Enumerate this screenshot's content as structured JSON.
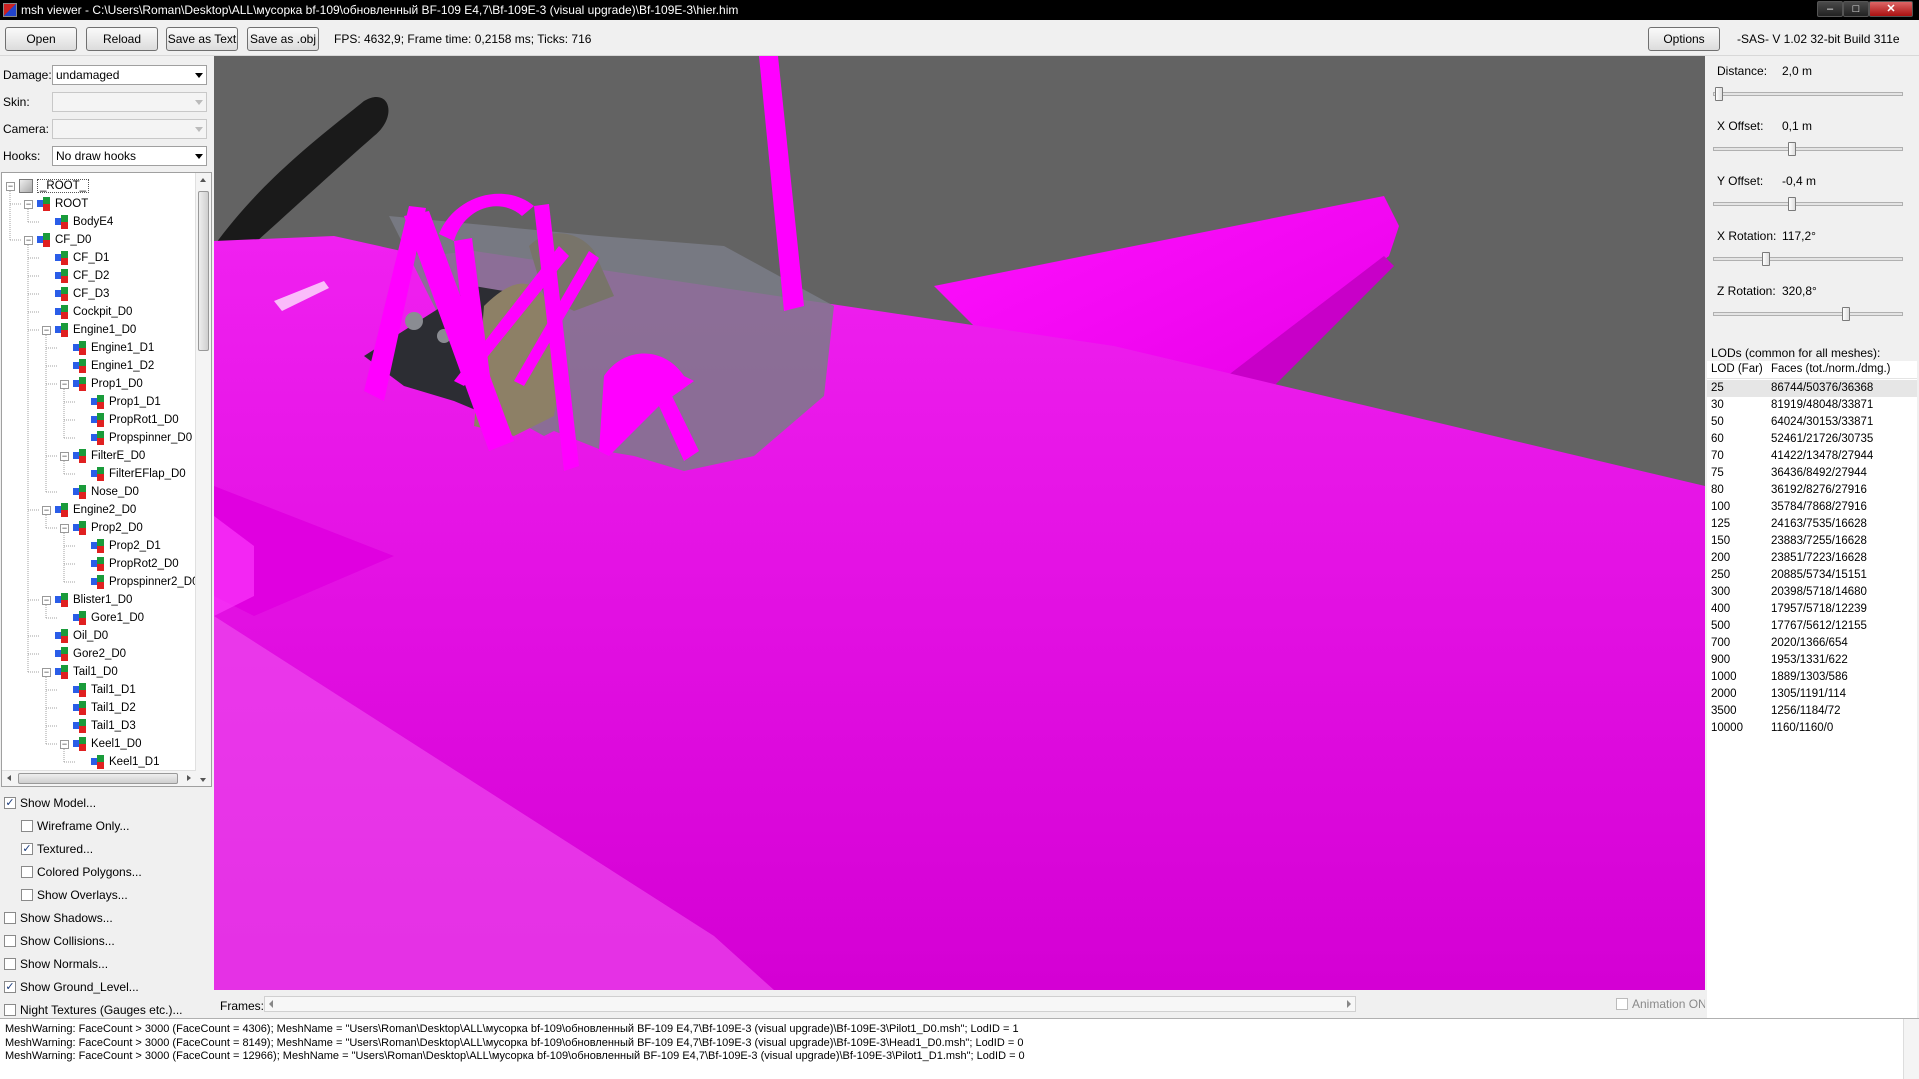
{
  "window": {
    "title": "msh viewer - C:\\Users\\Roman\\Desktop\\ALL\\мусорка bf-109\\обновленный BF-109 E4,7\\Bf-109E-3 (visual upgrade)\\Bf-109E-3\\hier.him",
    "min": "–",
    "max": "□",
    "close": "✕"
  },
  "toolbar": {
    "open": "Open",
    "reload": "Reload",
    "save_text": "Save as Text",
    "save_obj": "Save as .obj",
    "stats": "FPS: 4632,9; Frame time: 0,2158 ms; Ticks: 716",
    "options": "Options",
    "version": "-SAS- V 1.02  32-bit  Build 311e"
  },
  "left": {
    "damage_label": "Damage:",
    "damage_value": "undamaged",
    "skin_label": "Skin:",
    "skin_value": "",
    "camera_label": "Camera:",
    "camera_value": "",
    "hooks_label": "Hooks:",
    "hooks_value": "No draw hooks"
  },
  "tree": [
    {
      "label": "_ROOT_",
      "depth": 0,
      "exp": true,
      "root": true
    },
    {
      "label": "ROOT",
      "depth": 1,
      "exp": true
    },
    {
      "label": "BodyE4",
      "depth": 2
    },
    {
      "label": "CF_D0",
      "depth": 1,
      "exp": true
    },
    {
      "label": "CF_D1",
      "depth": 2
    },
    {
      "label": "CF_D2",
      "depth": 2
    },
    {
      "label": "CF_D3",
      "depth": 2
    },
    {
      "label": "Cockpit_D0",
      "depth": 2
    },
    {
      "label": "Engine1_D0",
      "depth": 2,
      "exp": true
    },
    {
      "label": "Engine1_D1",
      "depth": 3
    },
    {
      "label": "Engine1_D2",
      "depth": 3
    },
    {
      "label": "Prop1_D0",
      "depth": 3,
      "exp": true
    },
    {
      "label": "Prop1_D1",
      "depth": 4
    },
    {
      "label": "PropRot1_D0",
      "depth": 4
    },
    {
      "label": "Propspinner_D0",
      "depth": 4
    },
    {
      "label": "FilterE_D0",
      "depth": 3,
      "exp": true
    },
    {
      "label": "FilterEFlap_D0",
      "depth": 4
    },
    {
      "label": "Nose_D0",
      "depth": 3
    },
    {
      "label": "Engine2_D0",
      "depth": 2,
      "exp": true
    },
    {
      "label": "Prop2_D0",
      "depth": 3,
      "exp": true
    },
    {
      "label": "Prop2_D1",
      "depth": 4
    },
    {
      "label": "PropRot2_D0",
      "depth": 4
    },
    {
      "label": "Propspinner2_D0",
      "depth": 4
    },
    {
      "label": "Blister1_D0",
      "depth": 2,
      "exp": true
    },
    {
      "label": "Gore1_D0",
      "depth": 3
    },
    {
      "label": "Oil_D0",
      "depth": 2
    },
    {
      "label": "Gore2_D0",
      "depth": 2
    },
    {
      "label": "Tail1_D0",
      "depth": 2,
      "exp": true
    },
    {
      "label": "Tail1_D1",
      "depth": 3
    },
    {
      "label": "Tail1_D2",
      "depth": 3
    },
    {
      "label": "Tail1_D3",
      "depth": 3
    },
    {
      "label": "Keel1_D0",
      "depth": 3,
      "exp": true
    },
    {
      "label": "Keel1_D1",
      "depth": 4
    }
  ],
  "options": [
    {
      "label": "Show Model...",
      "checked": true,
      "indent": 0
    },
    {
      "label": "Wireframe Only...",
      "checked": false,
      "indent": 1
    },
    {
      "label": "Textured...",
      "checked": true,
      "indent": 1
    },
    {
      "label": "Colored Polygons...",
      "checked": false,
      "indent": 1
    },
    {
      "label": "Show Overlays...",
      "checked": false,
      "indent": 1
    },
    {
      "label": "Show Shadows...",
      "checked": false,
      "indent": 0
    },
    {
      "label": "Show Collisions...",
      "checked": false,
      "indent": 0
    },
    {
      "label": "Show Normals...",
      "checked": false,
      "indent": 0
    },
    {
      "label": "Show Ground_Level...",
      "checked": true,
      "indent": 0
    },
    {
      "label": "Night Textures (Gauges etc.)...",
      "checked": false,
      "indent": 0
    }
  ],
  "frames": {
    "label": "Frames:",
    "animation": "Animation ON"
  },
  "right": {
    "sliders": [
      {
        "label": "Distance:",
        "value": "2,0 m",
        "pos": 0.01
      },
      {
        "label": "X Offset:",
        "value": "0,1 m",
        "pos": 0.41
      },
      {
        "label": "Y Offset:",
        "value": "-0,4 m",
        "pos": 0.41
      },
      {
        "label": "X Rotation:",
        "value": "117,2°",
        "pos": 0.27
      },
      {
        "label": "Z Rotation:",
        "value": "320,8°",
        "pos": 0.71
      }
    ],
    "lods_label": "LODs (common for all meshes):",
    "lod_header": "LOD (Far)",
    "faces_header": "Faces (tot./norm./dmg.)",
    "lods": [
      [
        "25",
        "86744/50376/36368"
      ],
      [
        "30",
        "81919/48048/33871"
      ],
      [
        "50",
        "64024/30153/33871"
      ],
      [
        "60",
        "52461/21726/30735"
      ],
      [
        "70",
        "41422/13478/27944"
      ],
      [
        "75",
        "36436/8492/27944"
      ],
      [
        "80",
        "36192/8276/27916"
      ],
      [
        "100",
        "35784/7868/27916"
      ],
      [
        "125",
        "24163/7535/16628"
      ],
      [
        "150",
        "23883/7255/16628"
      ],
      [
        "200",
        "23851/7223/16628"
      ],
      [
        "250",
        "20885/5734/15151"
      ],
      [
        "300",
        "20398/5718/14680"
      ],
      [
        "400",
        "17957/5718/12239"
      ],
      [
        "500",
        "17767/5612/12155"
      ],
      [
        "700",
        "2020/1366/654"
      ],
      [
        "900",
        "1953/1331/622"
      ],
      [
        "1000",
        "1889/1303/586"
      ],
      [
        "2000",
        "1305/1191/114"
      ],
      [
        "3500",
        "1256/1184/72"
      ],
      [
        "10000",
        "1160/1160/0"
      ]
    ]
  },
  "log": [
    "MeshWarning: FaceCount > 3000 (FaceCount = 4306); MeshName = \"Users\\Roman\\Desktop\\ALL\\мусорка bf-109\\обновленный BF-109 E4,7\\Bf-109E-3 (visual upgrade)\\Bf-109E-3\\Pilot1_D0.msh\"; LodID = 1",
    "MeshWarning: FaceCount > 3000 (FaceCount = 8149); MeshName = \"Users\\Roman\\Desktop\\ALL\\мусорка bf-109\\обновленный BF-109 E4,7\\Bf-109E-3 (visual upgrade)\\Bf-109E-3\\Head1_D0.msh\"; LodID = 0",
    "MeshWarning: FaceCount > 3000 (FaceCount = 12966); MeshName = \"Users\\Roman\\Desktop\\ALL\\мусорка bf-109\\обновленный BF-109 E4,7\\Bf-109E-3 (visual upgrade)\\Bf-109E-3\\Pilot1_D1.msh\"; LodID = 0"
  ],
  "colors": {
    "viewport_bg": "#636363",
    "magenta": "#ff00ff",
    "canopy_glass": "#5f6470"
  }
}
